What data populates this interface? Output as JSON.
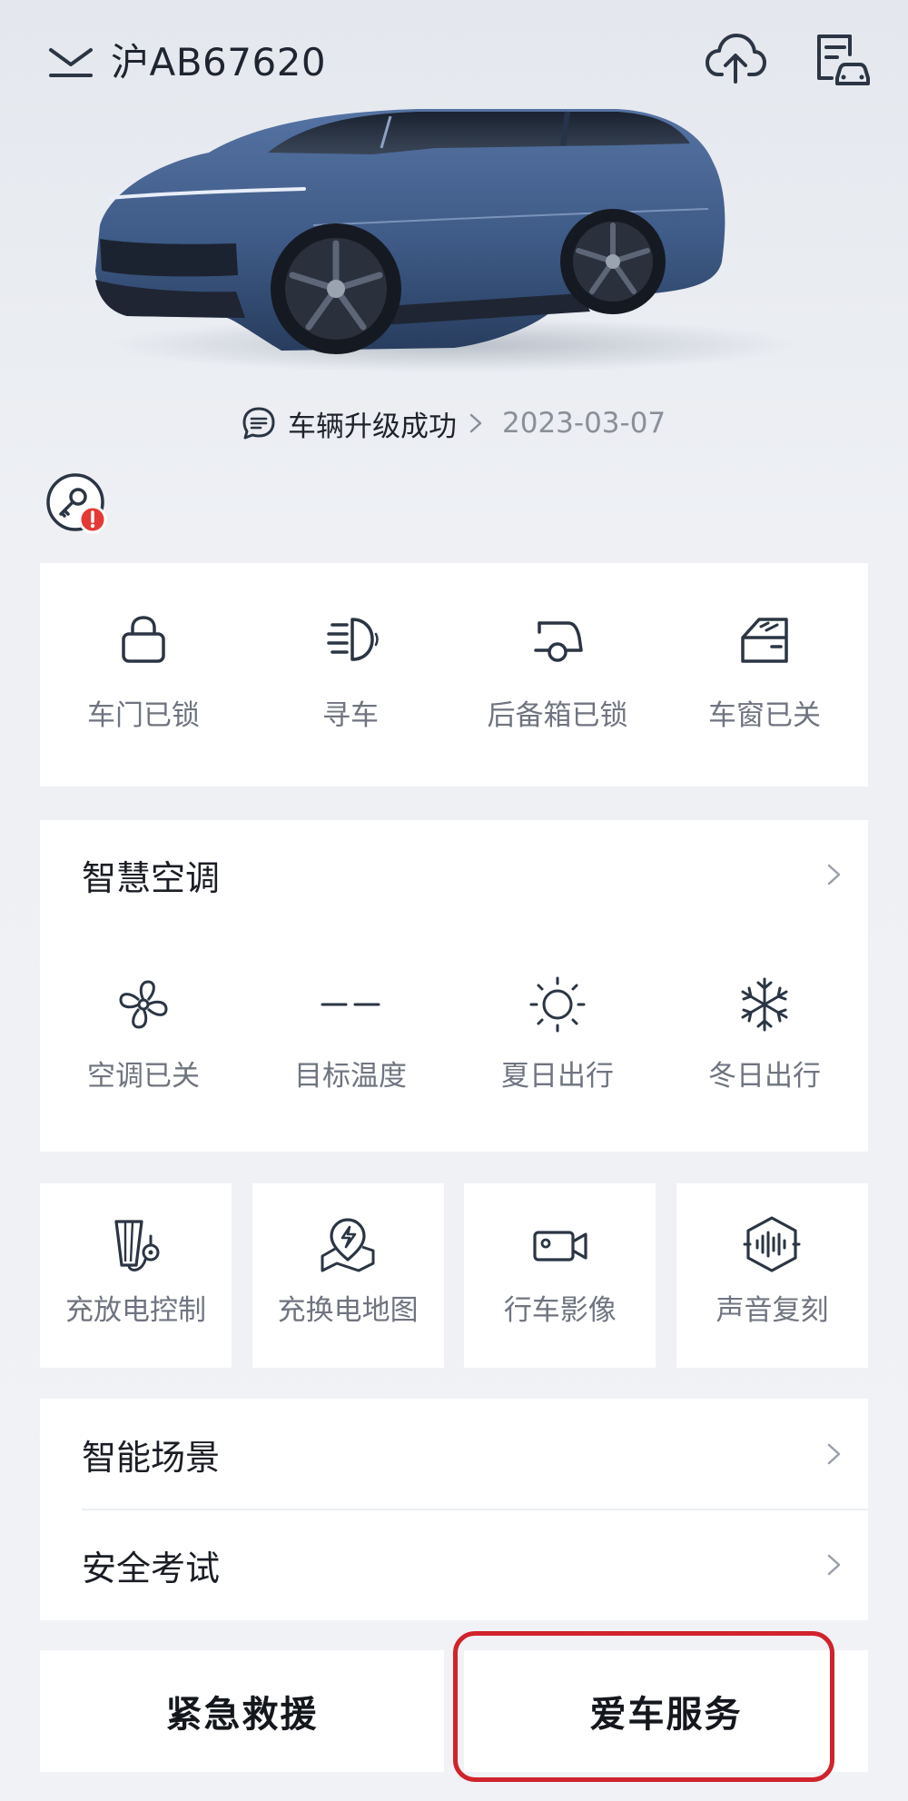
{
  "header": {
    "plate": "沪AB67620",
    "icons": {
      "expand": "chevron-down-icon",
      "upload": "cloud-upload-icon",
      "service": "service-document-icon"
    }
  },
  "notice": {
    "text": "车辆升级成功",
    "date": "2023-03-07"
  },
  "key": {
    "icon": "digital-key-icon",
    "alert_color": "#e53935"
  },
  "status": [
    {
      "label": "车门已锁",
      "icon": "lock-icon"
    },
    {
      "label": "寻车",
      "icon": "headlight-icon"
    },
    {
      "label": "后备箱已锁",
      "icon": "trunk-icon"
    },
    {
      "label": "车窗已关",
      "icon": "window-icon"
    }
  ],
  "climate": {
    "title": "智慧空调",
    "items": [
      {
        "label": "空调已关",
        "icon": "fan-icon"
      },
      {
        "label": "目标温度",
        "value": "– –"
      },
      {
        "label": "夏日出行",
        "icon": "sun-icon"
      },
      {
        "label": "冬日出行",
        "icon": "snowflake-icon"
      }
    ]
  },
  "tiles": [
    {
      "label": "充放电控制",
      "icon": "charge-control-icon"
    },
    {
      "label": "充换电地图",
      "icon": "charging-map-icon"
    },
    {
      "label": "行车影像",
      "icon": "camera-icon"
    },
    {
      "label": "声音复刻",
      "icon": "voice-icon"
    }
  ],
  "list": [
    {
      "label": "智能场景"
    },
    {
      "label": "安全考试"
    }
  ],
  "bottom": {
    "rescue": "紧急救援",
    "service": "爱车服务"
  },
  "colors": {
    "icon": "#2b3544",
    "label": "#6f7480",
    "highlight": "#d0232c",
    "car_body": "#3e5a86"
  }
}
